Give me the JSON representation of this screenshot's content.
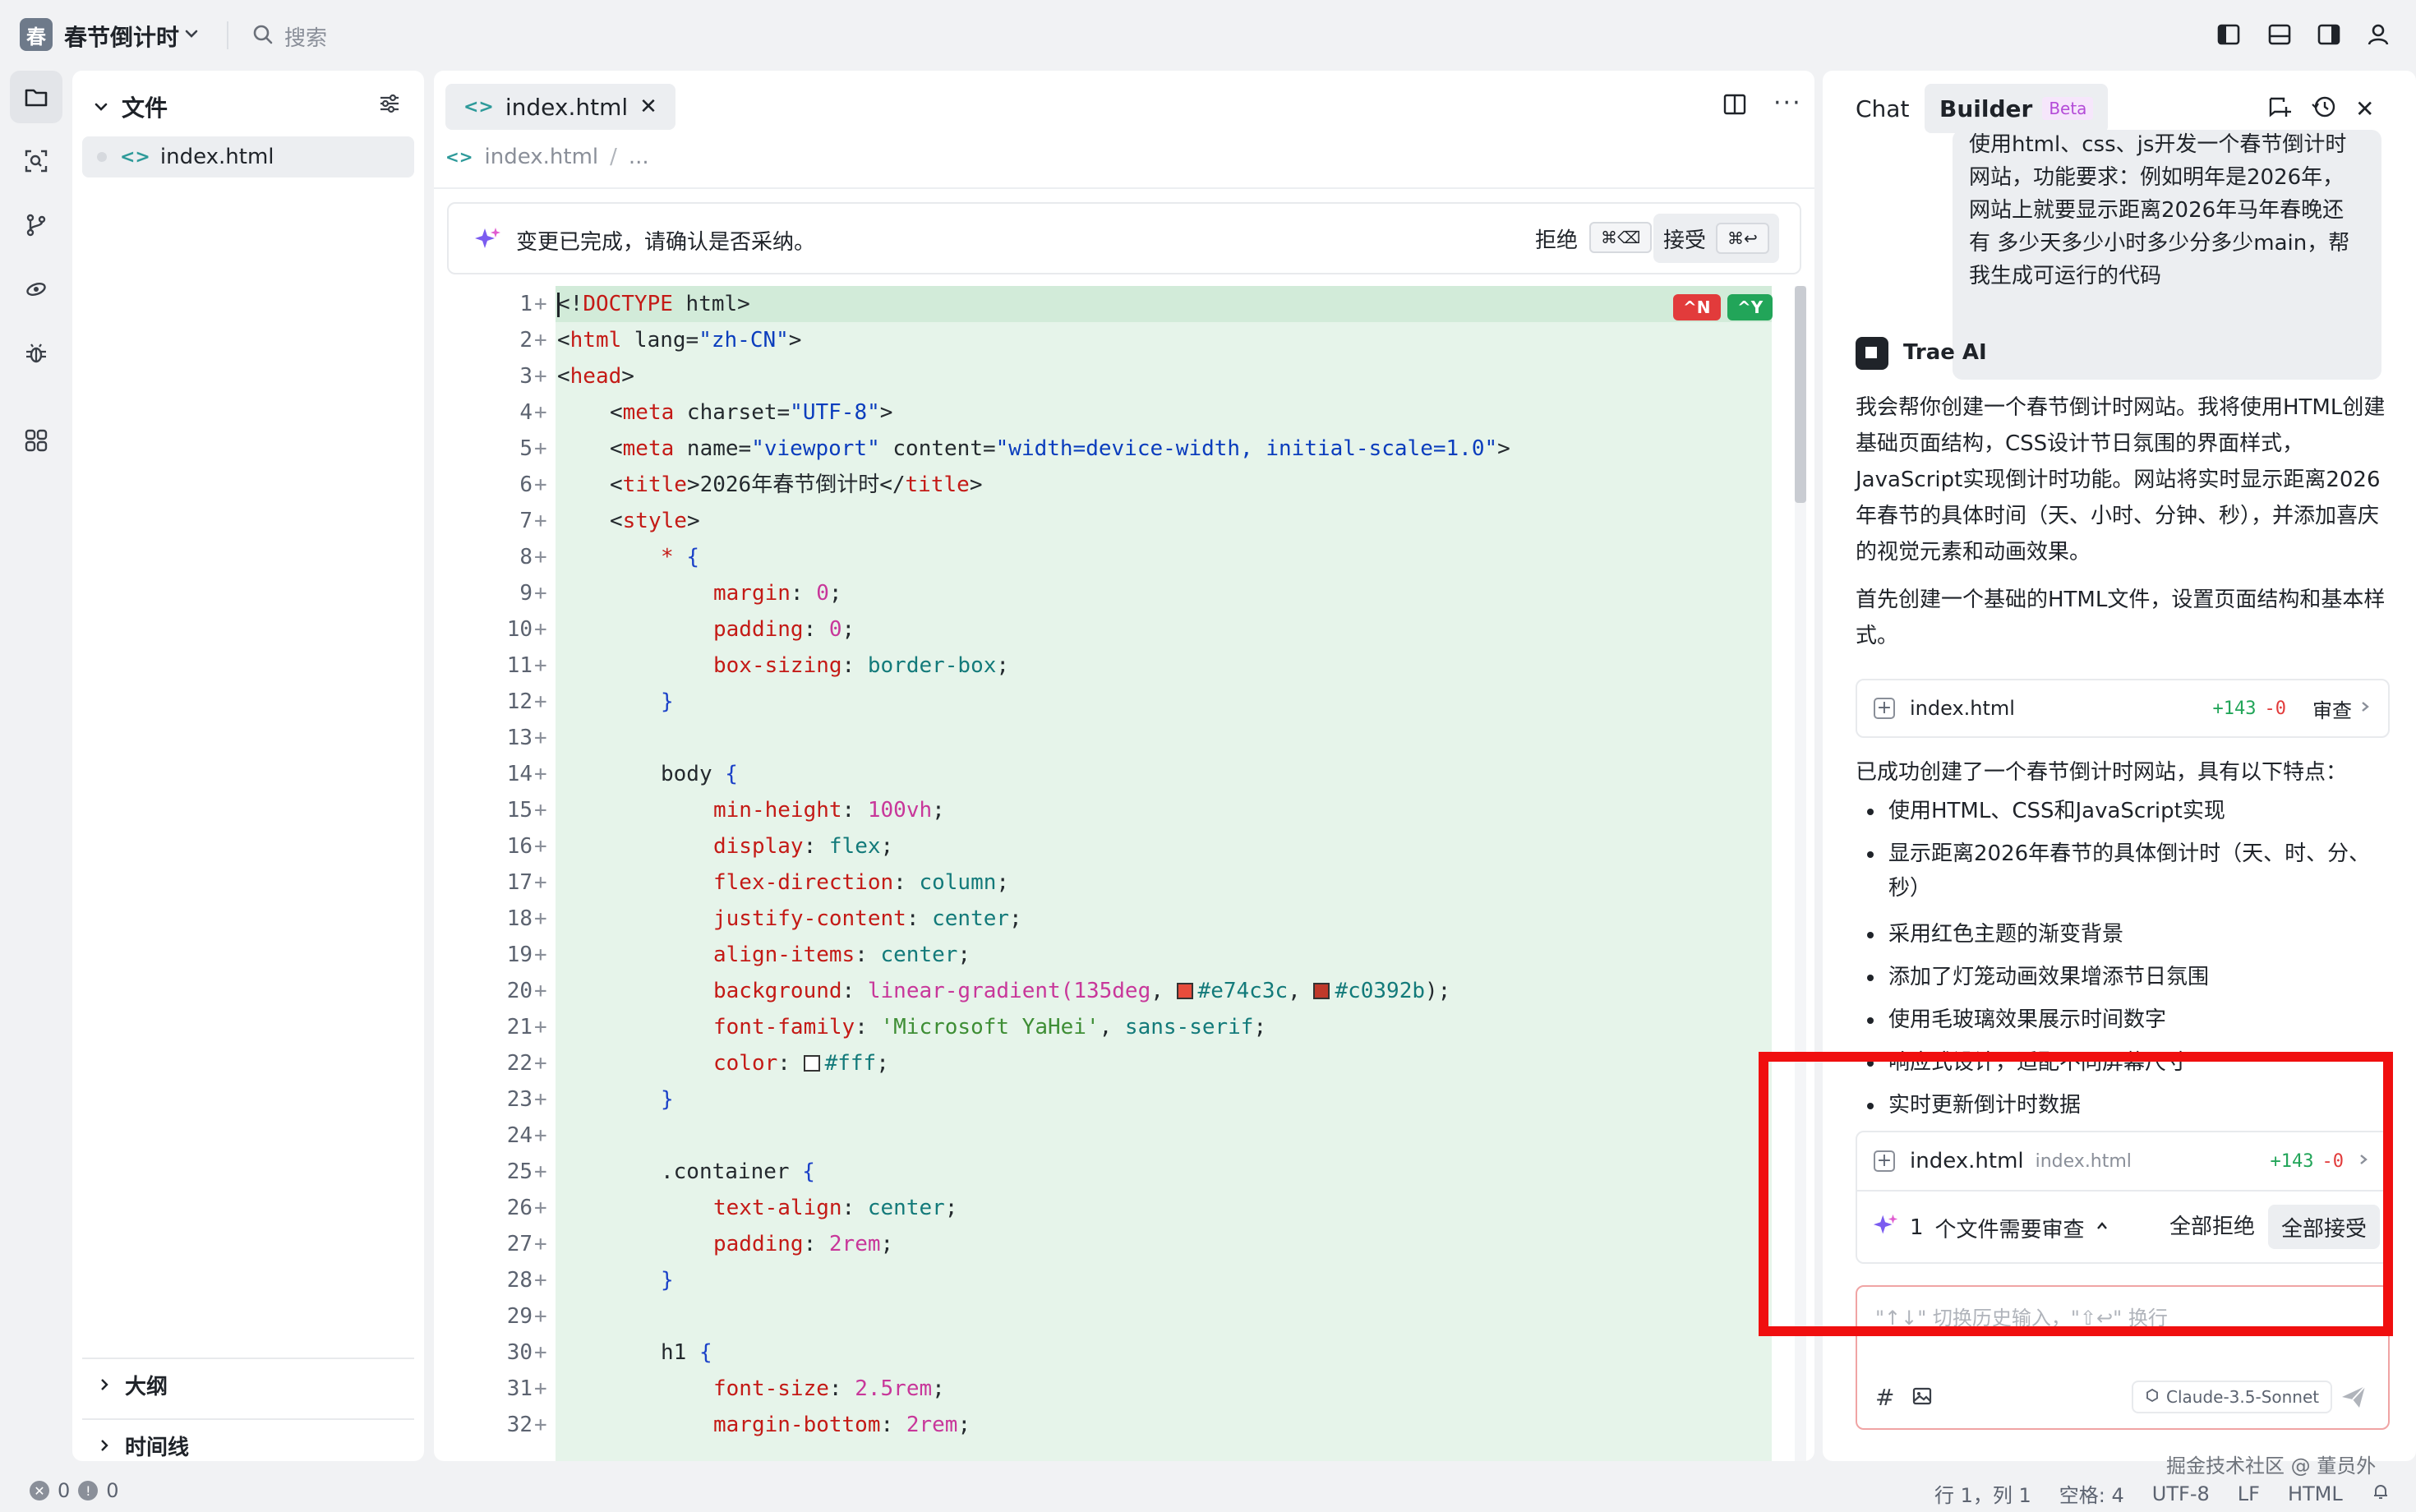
{
  "top_bar": {
    "logo_char": "春",
    "project_name": "春节倒计时",
    "search_label": "搜索"
  },
  "explorer": {
    "title": "文件",
    "file": {
      "code_glyph": "<>",
      "name": "index.html"
    },
    "sections": [
      "大纲",
      "时间线"
    ]
  },
  "editor": {
    "tab": {
      "code_glyph": "<>",
      "name": "index.html"
    },
    "breadcrumb": {
      "file": "index.html",
      "sep": "/",
      "rest": "..."
    },
    "review_bar": {
      "message": "变更已完成，请确认是否采纳。",
      "reject_label": "拒绝",
      "reject_shortcut": "⌘⌫",
      "accept_label": "接受",
      "accept_shortcut": "⌘↩"
    },
    "diff_keys": {
      "reject": "^N",
      "accept": "^Y"
    },
    "line_numbers": [
      "1",
      "2",
      "3",
      "4",
      "5",
      "6",
      "7",
      "8",
      "9",
      "10",
      "11",
      "12",
      "13",
      "14",
      "15",
      "16",
      "17",
      "18",
      "19",
      "20",
      "21",
      "22",
      "23",
      "24",
      "25",
      "26",
      "27",
      "28",
      "29",
      "30",
      "31",
      "32"
    ],
    "code": {
      "l1": {
        "open": "<!",
        "kw": "DOCTYPE",
        "rest": " html>"
      },
      "l2": {
        "open": "<",
        "tag": "html",
        "attr": " lang=",
        "str": "\"zh-CN\"",
        "close": ">"
      },
      "l3": {
        "open": "<",
        "tag": "head",
        "close": ">"
      },
      "l4": {
        "open": "<",
        "tag": "meta",
        "attr": " charset=",
        "str": "\"UTF-8\"",
        "close": ">"
      },
      "l5": {
        "open": "<",
        "tag": "meta",
        "attr1": " name=",
        "str1": "\"viewport\"",
        "attr2": " content=",
        "str2": "\"width=device-width, initial-scale=1.0\"",
        "close": ">"
      },
      "l6": {
        "open": "<",
        "tag": "title",
        "close1": ">",
        "text": "2026年春节倒计时",
        "open2": "</",
        "tag2": "title",
        "close2": ">"
      },
      "l7": {
        "open": "<",
        "tag": "style",
        "close": ">"
      },
      "l8": {
        "sel": "* ",
        "brace": "{"
      },
      "l9": {
        "prop": "margin",
        "colon": ": ",
        "num": "0",
        "semi": ";"
      },
      "l10": {
        "prop": "padding",
        "colon": ": ",
        "num": "0",
        "semi": ";"
      },
      "l11": {
        "prop": "box-sizing",
        "colon": ": ",
        "val": "border-box",
        "semi": ";"
      },
      "l12": {
        "brace": "}"
      },
      "l14": {
        "sel": "body ",
        "brace": "{"
      },
      "l15": {
        "prop": "min-height",
        "colon": ": ",
        "num": "100vh",
        "semi": ";"
      },
      "l16": {
        "prop": "display",
        "colon": ": ",
        "val": "flex",
        "semi": ";"
      },
      "l17": {
        "prop": "flex-direction",
        "colon": ": ",
        "val": "column",
        "semi": ";"
      },
      "l18": {
        "prop": "justify-content",
        "colon": ": ",
        "val": "center",
        "semi": ";"
      },
      "l19": {
        "prop": "align-items",
        "colon": ": ",
        "val": "center",
        "semi": ";"
      },
      "l20": {
        "prop": "background",
        "colon": ": ",
        "fn": "linear-gradient(",
        "num": "135deg",
        "comma1": ", ",
        "c1": "#e74c3c",
        "comma2": ", ",
        "c2": "#c0392b",
        "close": ");"
      },
      "l21": {
        "prop": "font-family",
        "colon": ": ",
        "sq": "'Microsoft YaHei'",
        "comma": ", ",
        "val": "sans-serif",
        "semi": ";"
      },
      "l22": {
        "prop": "color",
        "colon": ": ",
        "val": "#fff",
        "semi": ";"
      },
      "l23": {
        "brace": "}"
      },
      "l25": {
        "sel": ".container ",
        "brace": "{"
      },
      "l26": {
        "prop": "text-align",
        "colon": ": ",
        "val": "center",
        "semi": ";"
      },
      "l27": {
        "prop": "padding",
        "colon": ": ",
        "num": "2rem",
        "semi": ";"
      },
      "l28": {
        "brace": "}"
      },
      "l30": {
        "sel": "h1 ",
        "brace": "{"
      },
      "l31": {
        "prop": "font-size",
        "colon": ": ",
        "num": "2.5rem",
        "semi": ";"
      },
      "l32": {
        "prop": "margin-bottom",
        "colon": ": ",
        "num": "2rem",
        "semi": ";"
      }
    },
    "swatch_colors": {
      "c1": "#e74c3c",
      "c2": "#c0392b",
      "white": "#ffffff"
    }
  },
  "chat": {
    "tabs": {
      "chat": "Chat",
      "builder": "Builder",
      "beta": "Beta"
    },
    "user_message": "使用html、css、js开发一个春节倒计时网站，功能要求：例如明年是2026年，网站上就要显示距离2026年马年春晚还有 多少天多少小时多少分多少main，帮我生成可运行的代码",
    "ai_name": "Trae AI",
    "ai_para1": "我会帮你创建一个春节倒计时网站。我将使用HTML创建基础页面结构，CSS设计节日氛围的界面样式，JavaScript实现倒计时功能。网站将实时显示距离2026年春节的具体时间（天、小时、分钟、秒），并添加喜庆的视觉元素和动画效果。",
    "ai_para2": "首先创建一个基础的HTML文件，设置页面结构和基本样式。",
    "file_card": {
      "name": "index.html",
      "added": "+143",
      "removed": "-0",
      "review": "审查"
    },
    "success_text": "已成功创建了一个春节倒计时网站，具有以下特点：",
    "features": [
      "使用HTML、CSS和JavaScript实现",
      "显示距离2026年春节的具体倒计时（天、时、分、秒）",
      "采用红色主题的渐变背景",
      "添加了灯笼动画效果增添节日氛围",
      "使用毛玻璃效果展示时间数字",
      "响应式设计，适配不同屏幕尺寸",
      "实时更新倒计时数据"
    ],
    "review_card": {
      "file_name": "index.html",
      "file_path": "index.html",
      "added": "+143",
      "removed": "-0",
      "count": "1",
      "needs_review": "个文件需要审查",
      "reject_all": "全部拒绝",
      "accept_all": "全部接受"
    },
    "input": {
      "placeholder": "\"↑↓\" 切换历史输入，\"⇧↩\" 换行",
      "hash": "#",
      "model": "Claude-3.5-Sonnet"
    },
    "highlight_color": "#f00f0f"
  },
  "status_bar": {
    "errors": "0",
    "warnings": "0",
    "position": "行 1，列 1",
    "spaces": "空格: 4",
    "encoding": "UTF-8",
    "eol": "LF",
    "language": "HTML"
  },
  "watermark": "掘金技术社区 @ 董员外"
}
